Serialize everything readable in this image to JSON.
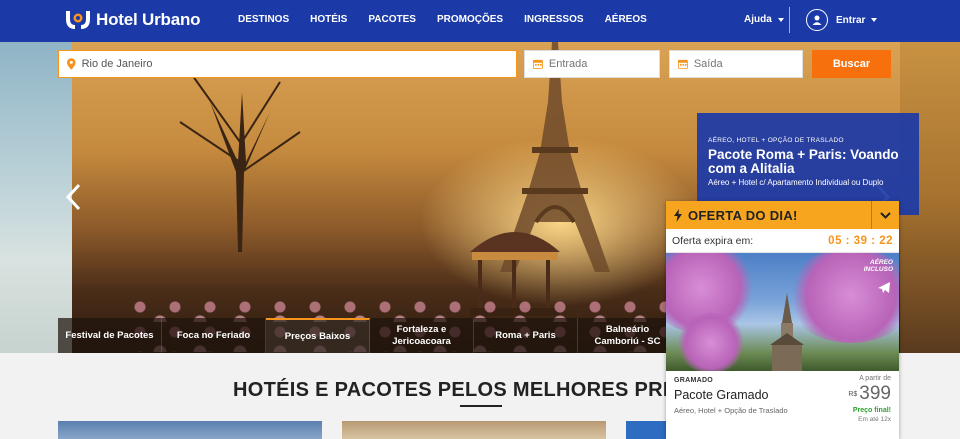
{
  "header": {
    "brand": "Hotel Urbano",
    "nav": [
      "DESTINOS",
      "HOTÉIS",
      "PACOTES",
      "PROMOÇÕES",
      "INGRESSOS",
      "AÉREOS"
    ],
    "help": "Ajuda",
    "login": "Entrar"
  },
  "search": {
    "destination_value": "Rio de Janeiro",
    "checkin_placeholder": "Entrada",
    "checkout_placeholder": "Saída",
    "button": "Buscar"
  },
  "promo": {
    "kicker": "AÉREO, HOTEL + OPÇÃO DE TRASLADO",
    "title": "Pacote Roma + Paris: Voando com a Alitalia",
    "subtitle": "Aéreo + Hotel c/ Apartamento Individual ou Duplo"
  },
  "tabs": [
    {
      "label": "Festival de Pacotes"
    },
    {
      "label": "Foca no Feriado"
    },
    {
      "label": "Preços Baixos"
    },
    {
      "label": "Fortaleza e Jericoacoara"
    },
    {
      "label": "Roma + Paris"
    },
    {
      "label": "Balneário Camboriú - SC"
    }
  ],
  "section": {
    "title": "HOTÉIS E PACOTES PELOS MELHORES PRE"
  },
  "offer": {
    "title": "OFERTA DO DIA!",
    "expires_label": "Oferta expira em:",
    "time": "05 : 39 : 22",
    "badge_line1": "AÉREO",
    "badge_line2": "INCLUSO",
    "city": "GRAMADO",
    "name": "Pacote Gramado",
    "description": "Aéreo, Hotel + Opção de Traslado",
    "price_from": "A partir de",
    "currency": "R$",
    "price": "399",
    "price_note": "Preço final!",
    "installments": "Em até 12x"
  },
  "colors": {
    "brand_blue": "#1b3aa8",
    "accent_orange": "#f7941d",
    "button_orange": "#f7700e",
    "offer_yellow": "#f7a51f"
  }
}
